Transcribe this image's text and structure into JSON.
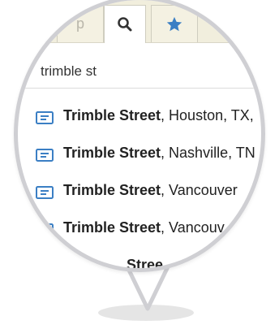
{
  "tabs": [
    {
      "label": "p",
      "icon": "map-icon"
    },
    {
      "label": "",
      "icon": "search-icon"
    },
    {
      "label": "",
      "icon": "star-icon"
    }
  ],
  "search": {
    "value": "trimble st"
  },
  "results": [
    {
      "name": "Trimble Street",
      "location": ", Houston, TX,"
    },
    {
      "name": "Trimble Street",
      "location": ", Nashville, TN"
    },
    {
      "name": "Trimble Street",
      "location": ", Vancouver"
    },
    {
      "name": "Trimble Street",
      "location": ", Vancouv"
    },
    {
      "name": "Stree",
      "location": ""
    }
  ],
  "colors": {
    "icon_blue": "#3b7fc4",
    "ring": "#cfcfd3",
    "tab_bg": "#f1eedd"
  }
}
